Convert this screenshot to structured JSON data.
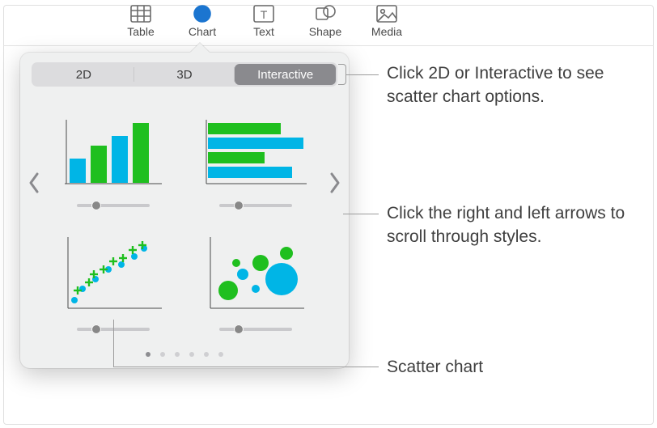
{
  "toolbar": {
    "items": [
      {
        "label": "Table"
      },
      {
        "label": "Chart"
      },
      {
        "label": "Text"
      },
      {
        "label": "Shape"
      },
      {
        "label": "Media"
      }
    ]
  },
  "popover": {
    "segments": {
      "a": "2D",
      "b": "3D",
      "c": "Interactive"
    },
    "page_count": 6,
    "active_page": 0
  },
  "annotations": {
    "segments": "Click 2D or Interactive to see scatter chart options.",
    "arrows": "Click the right and left arrows to scroll through styles.",
    "scatter": "Scatter chart"
  }
}
